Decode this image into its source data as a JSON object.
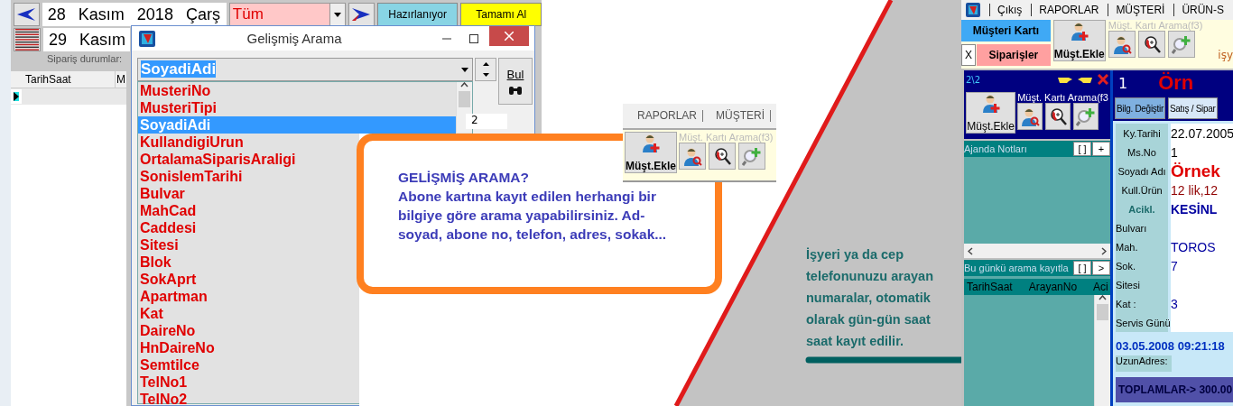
{
  "left_app": {
    "date_rows": [
      {
        "day": "28",
        "month": "Kasım",
        "year": "2018",
        "weekday": "Çarş"
      },
      {
        "day": "29",
        "month": "Kasım"
      }
    ],
    "filter": {
      "value": "Tüm"
    },
    "status_buttons": [
      {
        "label": "Hazırlanıyor",
        "color": "#88d4e4"
      },
      {
        "label": "Tamamı Al",
        "color": "#ffff00"
      }
    ],
    "status_caption": "Sipariş durumlar:",
    "grid": {
      "columns": [
        "TarihSaat",
        "M"
      ]
    }
  },
  "dialog": {
    "title": "Gelişmiş Arama",
    "field": {
      "value": "SoyadiAdi"
    },
    "find_button": "Bul",
    "side_cell": "2",
    "options": [
      {
        "label": "MusteriNo",
        "selected": false
      },
      {
        "label": "MusteriTipi",
        "selected": false
      },
      {
        "label": "SoyadiAdi",
        "selected": true
      },
      {
        "label": "KullandigiUrun",
        "selected": false
      },
      {
        "label": "OrtalamaSiparisAraligi",
        "selected": false
      },
      {
        "label": "SonislemTarihi",
        "selected": false
      },
      {
        "label": "Bulvar",
        "selected": false
      },
      {
        "label": "MahCad",
        "selected": false
      },
      {
        "label": "Caddesi",
        "selected": false
      },
      {
        "label": "Sitesi",
        "selected": false
      },
      {
        "label": "Blok",
        "selected": false
      },
      {
        "label": "SokAprt",
        "selected": false
      },
      {
        "label": "Apartman",
        "selected": false
      },
      {
        "label": "Kat",
        "selected": false
      },
      {
        "label": "DaireNo",
        "selected": false
      },
      {
        "label": "HnDaireNo",
        "selected": false
      },
      {
        "label": "Semtilce",
        "selected": false
      },
      {
        "label": "TelNo1",
        "selected": false
      },
      {
        "label": "TelNo2",
        "selected": false
      }
    ]
  },
  "callout": {
    "title": "GELİŞMİŞ ARAMA?",
    "text": "Abone kartına kayıt edilen herhangi bir bilgiye göre arama yapabilirsiniz. Ad-soyad, abone no, telefon, adres, sokak..."
  },
  "toolbar_snippet": {
    "menu": [
      "RAPORLAR",
      "MÜŞTERİ"
    ],
    "caption": "Müşt. Kartı Arama(f3)",
    "add_button": "Müşt.Ekle"
  },
  "note": {
    "text": "İşyeri ya da cep telefonunuzu arayan numaralar, otomatik olarak gün-gün saat saat kayıt edilir."
  },
  "right_app": {
    "menu": [
      "Çıkış",
      "RAPORLAR",
      "MÜŞTERİ",
      "ÜRÜN-S"
    ],
    "tabs": [
      {
        "label": "Müşteri Kartı",
        "color": "#3fa9f5"
      },
      {
        "label": "Siparişler",
        "color": "#ffa0a0"
      }
    ],
    "close_tab": "X",
    "add_button": "Müşt.Ekle",
    "caption": "Müşt. Kartı Arama(f3)",
    "hint": "işy",
    "side_panel": {
      "counter": "2\\2",
      "add_button": "Müşt.Ekle",
      "caption": "Müşt. Kartı Arama(f3",
      "agenda": {
        "title": "Ajanda Notları",
        "buttons": [
          "[ ]",
          "+"
        ]
      },
      "calls": {
        "title": "Bu günkü arama kayıtla",
        "buttons": [
          "[ ]",
          ">"
        ],
        "columns": [
          "TarihSaat",
          "ArayanNo",
          "Aci"
        ]
      }
    },
    "card": {
      "number": "1",
      "name": "Örn",
      "buttons": [
        {
          "label": "Bilg. Değiştir",
          "selected": true
        },
        {
          "label": "Satış / Sipar",
          "selected": false
        }
      ],
      "fields": [
        {
          "label": "Ky.Tarihi",
          "value": "22.07.2005",
          "kind": "plain"
        },
        {
          "label": "Ms.No",
          "value": "1",
          "kind": "plain"
        },
        {
          "label": "Soyadı Adı",
          "value": "Örnek",
          "kind": "name"
        },
        {
          "label": "Kull.Ürün",
          "value": "12 lik,12",
          "kind": "product"
        },
        {
          "label": "Acikl.",
          "value": "KESİNL",
          "kind": "note"
        },
        {
          "label": "Bulvarı",
          "kind": "address"
        },
        {
          "label": "Mah.",
          "value": "TOROS",
          "kind": "address"
        },
        {
          "label": "Sok.",
          "value": "7",
          "kind": "address"
        },
        {
          "label": "Sitesi",
          "kind": "address"
        },
        {
          "label": "Kat :",
          "value": "3",
          "kind": "address"
        },
        {
          "label": "Servis Günü",
          "kind": "address"
        }
      ],
      "timestamp": "03.05.2008 09:21:18",
      "long_address_label": "UzunAdres:",
      "totals": "TOPLAMLAR-> 300.00"
    }
  }
}
